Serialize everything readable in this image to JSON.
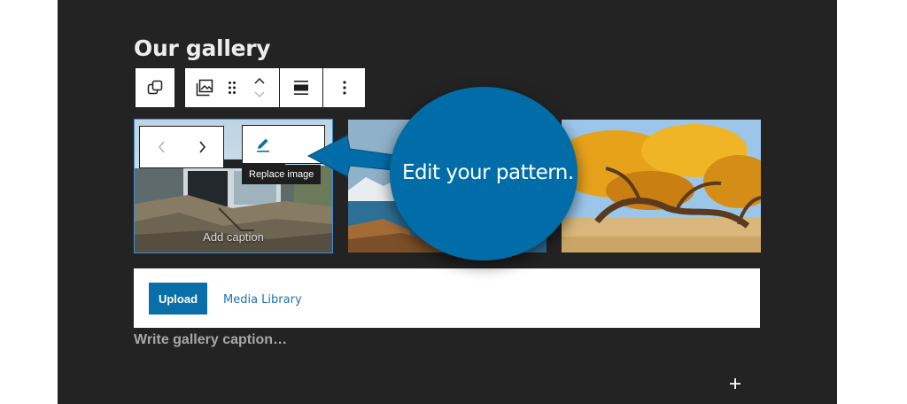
{
  "heading": "Our gallery",
  "toolbar": {
    "transform_icon": "duplicate-icon",
    "gallery_icon": "gallery-icon",
    "drag_icon": "drag-handle-icon",
    "move_icon": "up-down-arrows-icon",
    "align_icon": "align-icon",
    "more_icon": "more-options-icon"
  },
  "image_toolbar": {
    "prev_icon": "chevron-left-icon",
    "next_icon": "chevron-right-icon",
    "edit_icon": "pencil-icon",
    "tooltip": "Replace image"
  },
  "images": [
    {
      "caption": "Add caption",
      "subject": "modern house on rocks"
    },
    {
      "subject": "lake with snowy mountains"
    },
    {
      "subject": "yellow autumn trees"
    }
  ],
  "upload": {
    "upload_label": "Upload",
    "media_library_label": "Media Library"
  },
  "gallery_caption_placeholder": "Write gallery caption…",
  "callout": {
    "text": "Edit your pattern.",
    "color": "#006da8"
  },
  "colors": {
    "editor_bg": "#232324",
    "accent": "#0a6fa8",
    "link": "#2271b1"
  }
}
